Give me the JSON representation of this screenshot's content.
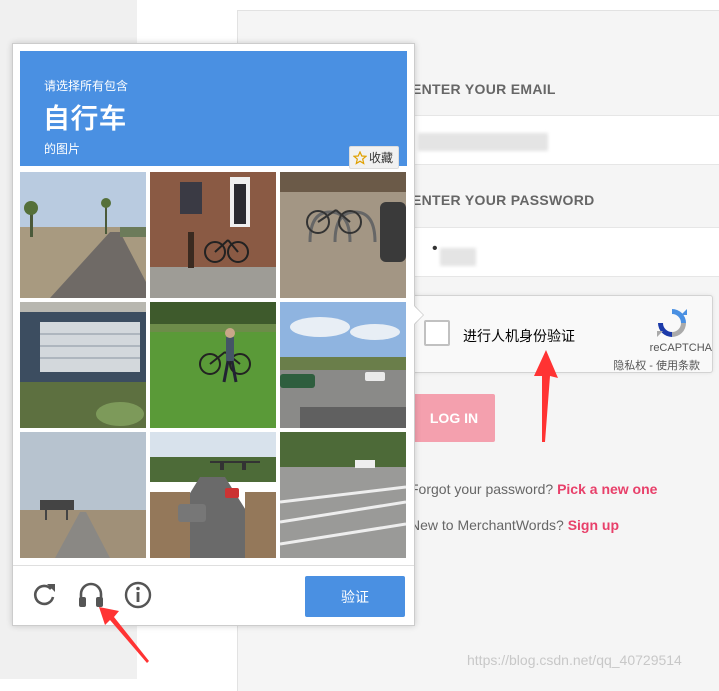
{
  "login": {
    "email_label": "ENTER YOUR EMAIL",
    "password_label": "ENTER YOUR PASSWORD",
    "password_value": "•",
    "login_button": "LOG IN",
    "forgot_text": "Forgot your password?",
    "forgot_link": "Pick a new one",
    "new_text": "New to MerchantWords?",
    "signup_link": "Sign up"
  },
  "recaptcha": {
    "checkbox_label": "进行人机身份验证",
    "brand": "reCAPTCHA",
    "privacy": "隐私权",
    "separator": " - ",
    "terms": "使用条款"
  },
  "challenge": {
    "instruction_top": "请选择所有包含",
    "target_object": "自行车",
    "instruction_bottom": "的图片",
    "favorite_label": "收藏",
    "verify_button": "验证",
    "tiles": [
      "road-desert-palms",
      "building-bicycle",
      "bike-rack",
      "porch-house",
      "man-with-bike-lawn",
      "intersection-car",
      "highway-sign",
      "traffic-lights-road",
      "crosswalk-road"
    ]
  },
  "icons": {
    "reload": "reload-icon",
    "audio": "headphones-icon",
    "info": "info-icon",
    "star": "star-icon",
    "recaptcha_logo": "recaptcha-logo-icon"
  },
  "colors": {
    "banner_blue": "#4a90e2",
    "link_pink": "#e8406a",
    "login_button": "#f4a0ae",
    "arrow_red": "#ff3333"
  },
  "watermark": "https://blog.csdn.net/qq_40729514"
}
